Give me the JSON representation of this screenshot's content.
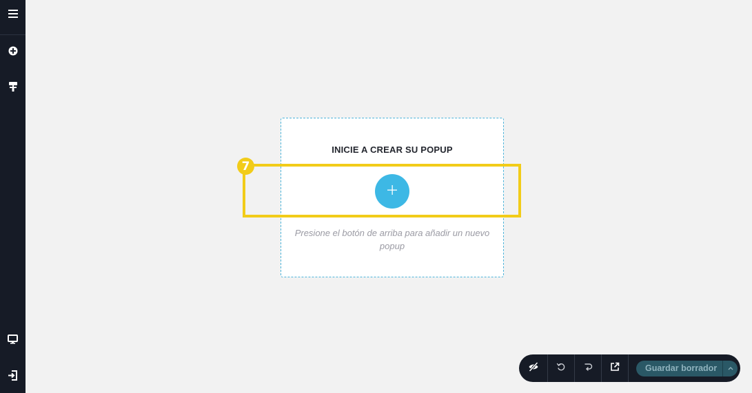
{
  "sidebar": {
    "items": [
      {
        "name": "menu",
        "icon": "hamburger-menu-icon"
      },
      {
        "name": "add-element",
        "icon": "plus-circle-icon"
      },
      {
        "name": "paint",
        "icon": "paint-roller-icon"
      },
      {
        "name": "preview-device",
        "icon": "desktop-monitor-icon"
      },
      {
        "name": "exit",
        "icon": "exit-icon"
      }
    ]
  },
  "popup_card": {
    "title": "INICIE A CREAR SU POPUP",
    "add_icon": "plus-icon",
    "hint": "Presione el botón de arriba para añadir un nuevo popup"
  },
  "tutorial": {
    "step_number": "7",
    "highlight_color": "#f2cc19"
  },
  "toolbar": {
    "buttons": [
      {
        "name": "toggle-visibility",
        "icon": "eye-slash-icon"
      },
      {
        "name": "undo",
        "icon": "undo-icon"
      },
      {
        "name": "redo",
        "icon": "redo-icon"
      },
      {
        "name": "open-preview",
        "icon": "external-link-icon"
      }
    ],
    "save_label": "Guardar borrador",
    "save_menu_icon": "chevron-up-icon"
  },
  "colors": {
    "sidebar_bg": "#161b26",
    "canvas_bg": "#f2f2f2",
    "accent": "#3db8e5",
    "save_button_bg": "#2a5866"
  }
}
